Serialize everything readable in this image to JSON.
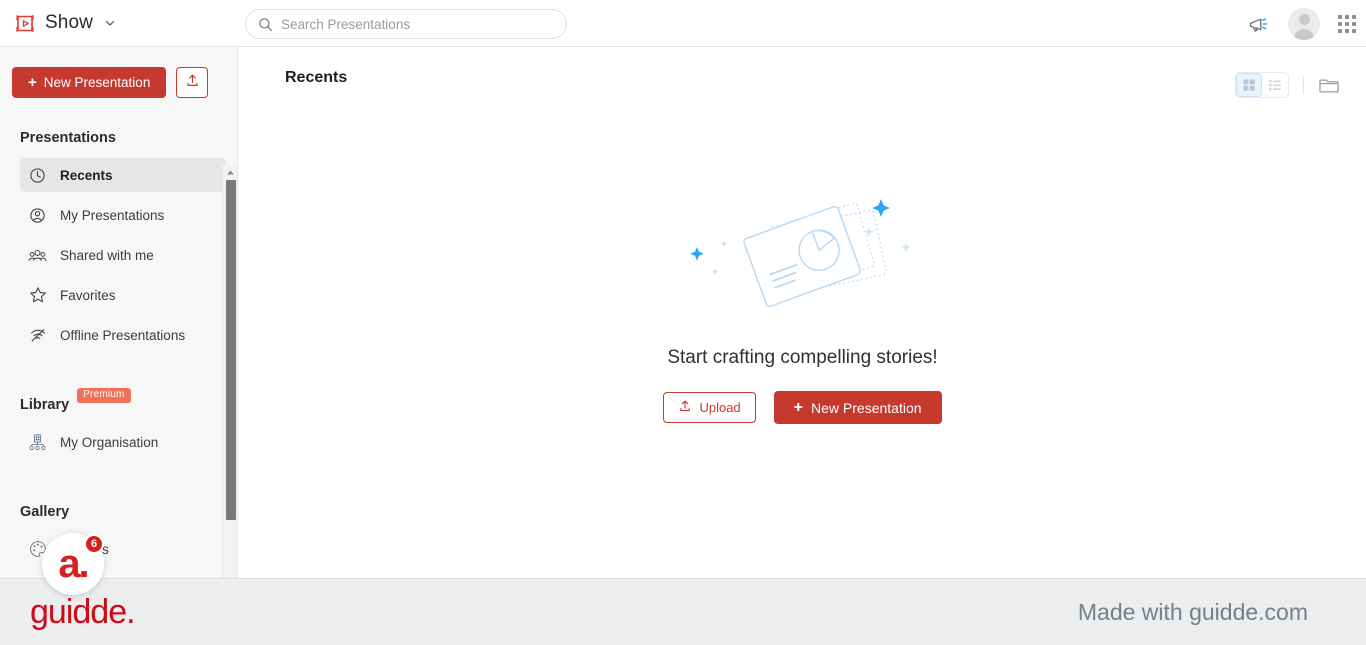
{
  "topbar": {
    "brand_name": "Show",
    "brand_icon": "show-play-logo-icon",
    "chevron_icon": "chevron-down-icon",
    "search": {
      "placeholder": "Search Presentations",
      "value": "",
      "icon": "search-icon"
    },
    "announcement_icon": "megaphone-icon",
    "avatar_icon": "user-avatar",
    "apps_icon": "apps-grid-icon"
  },
  "sidebar": {
    "new_presentation_label": "New Presentation",
    "new_presentation_plus": "+",
    "upload_icon": "upload-icon",
    "presentations_section": "Presentations",
    "nav_items": [
      {
        "label": "Recents",
        "icon": "clock-icon",
        "active": true
      },
      {
        "label": "My Presentations",
        "icon": "user-circle-icon",
        "active": false
      },
      {
        "label": "Shared with me",
        "icon": "people-group-icon",
        "active": false
      },
      {
        "label": "Favorites",
        "icon": "star-icon",
        "active": false
      },
      {
        "label": "Offline Presentations",
        "icon": "offline-wifi-icon",
        "active": false
      }
    ],
    "library_section": "Library",
    "premium_badge": "Premium",
    "library_items": [
      {
        "label": "My Organisation",
        "icon": "organisation-icon"
      }
    ],
    "gallery_section": "Gallery",
    "gallery_items": [
      {
        "label": "Themes",
        "icon": "palette-icon"
      }
    ],
    "scrollbar": {
      "up_icon": "scroll-up-arrow-icon",
      "down_icon": "scroll-down-arrow-icon"
    }
  },
  "main": {
    "page_title": "Recents",
    "view_controls": {
      "grid_icon": "grid-view-icon",
      "list_icon": "list-view-icon",
      "folder_icon": "folder-icon",
      "selected": "grid"
    },
    "empty_state": {
      "illustration": "presentation-slides-sparkles-illustration",
      "title": "Start crafting compelling stories!",
      "upload_label": "Upload",
      "upload_icon": "upload-icon",
      "new_presentation_label": "New Presentation",
      "new_presentation_plus": "+"
    }
  },
  "guidde_bar": {
    "logo_text": "guidde.",
    "made_with_text": "Made with guidde.com"
  },
  "float_widget": {
    "logo_text": "a.",
    "badge_count": "6"
  },
  "colors": {
    "brand_red": "#c6392f",
    "premium_coral": "#f2705a",
    "guidde_red": "#cf0a1b",
    "accent_blue": "#29a7f5",
    "sidebar_bg": "#f7f7f7",
    "guidde_bar_bg": "#ebedee"
  }
}
